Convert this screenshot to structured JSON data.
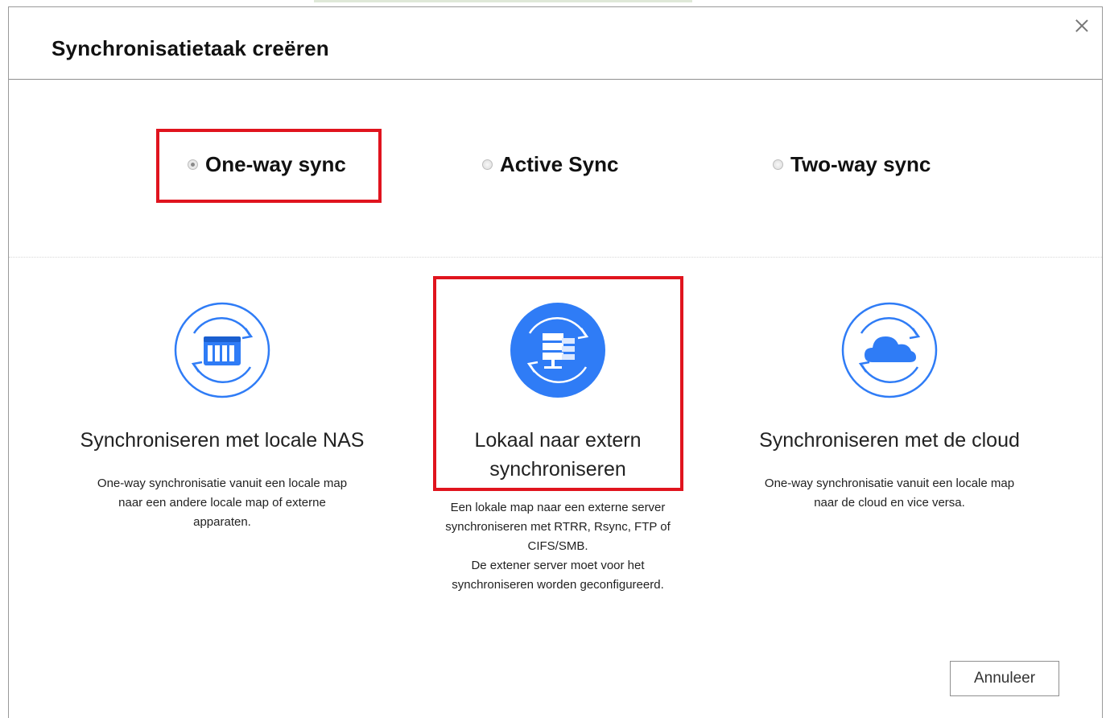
{
  "dialog": {
    "title": "Synchronisatietaak creëren",
    "close_icon": "close-icon"
  },
  "sync_modes": [
    {
      "label": "One-way sync",
      "selected": true
    },
    {
      "label": "Active Sync",
      "selected": false
    },
    {
      "label": "Two-way sync",
      "selected": false
    }
  ],
  "options": [
    {
      "title_lines": [
        "Synchroniseren met locale NAS"
      ],
      "desc_lines": [
        "One-way synchronisatie vanuit een locale map",
        "naar een andere locale map of externe",
        "apparaten."
      ],
      "icon": "nas-sync-icon"
    },
    {
      "title_lines": [
        "Lokaal naar extern",
        "synchroniseren"
      ],
      "desc_lines": [
        "Een lokale map naar een externe server",
        "synchroniseren met RTRR, Rsync, FTP of",
        "CIFS/SMB.",
        "De extener server moet voor het",
        "synchroniseren worden geconfigureerd."
      ],
      "icon": "remote-server-sync-icon"
    },
    {
      "title_lines": [
        "Synchroniseren met de cloud"
      ],
      "desc_lines": [
        "One-way synchronisatie vanuit een locale map",
        "naar de cloud en vice versa."
      ],
      "icon": "cloud-sync-icon"
    }
  ],
  "footer": {
    "cancel_label": "Annuleer"
  },
  "colors": {
    "accent": "#2f7cf6",
    "highlight": "#e0141e"
  }
}
